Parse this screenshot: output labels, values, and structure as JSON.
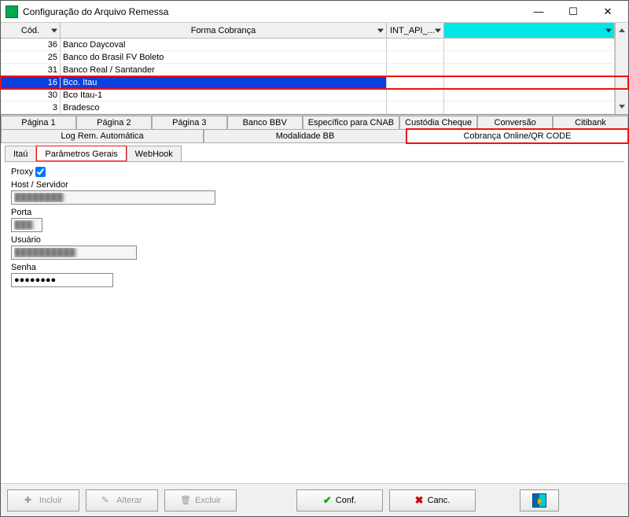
{
  "window": {
    "title": "Configuração do Arquivo Remessa"
  },
  "grid": {
    "headers": {
      "cod": "Cód.",
      "forma": "Forma Cobrança",
      "int": "INT_API_..."
    },
    "rows": [
      {
        "cod": "36",
        "forma": "Banco Daycoval",
        "selected": false
      },
      {
        "cod": "25",
        "forma": "Banco do Brasil FV Boleto",
        "selected": false
      },
      {
        "cod": "31",
        "forma": "Banco Real / Santander",
        "selected": false
      },
      {
        "cod": "16",
        "forma": "Bco. Itau",
        "selected": true
      },
      {
        "cod": "30",
        "forma": "Bco Itau-1",
        "selected": false
      },
      {
        "cod": "3",
        "forma": "Bradesco",
        "selected": false
      }
    ]
  },
  "tabs_row1": [
    "Página 1",
    "Página 2",
    "Página 3",
    "Banco BBV",
    "Específico para CNAB",
    "Custódia Cheque",
    "Conversão",
    "Citibank"
  ],
  "tabs_row2": {
    "log": "Log Rem. Automática",
    "mod": "Modalidade BB",
    "cob": "Cobrança Online/QR CODE"
  },
  "subtabs": {
    "itau": "Itaú",
    "param": "Parâmetros Gerais",
    "webhook": "WebHook"
  },
  "form": {
    "proxy_label": "Proxy",
    "proxy_checked": true,
    "host_label": "Host / Servidor",
    "host_value": "████████",
    "porta_label": "Porta",
    "porta_value": "███",
    "usuario_label": "Usuário",
    "usuario_value": "██████████",
    "senha_label": "Senha",
    "senha_value": "●●●●●●●●"
  },
  "buttons": {
    "incluir": "Incluir",
    "alterar": "Alterar",
    "excluir": "Excluir",
    "conf": "Conf.",
    "canc": "Canc."
  }
}
